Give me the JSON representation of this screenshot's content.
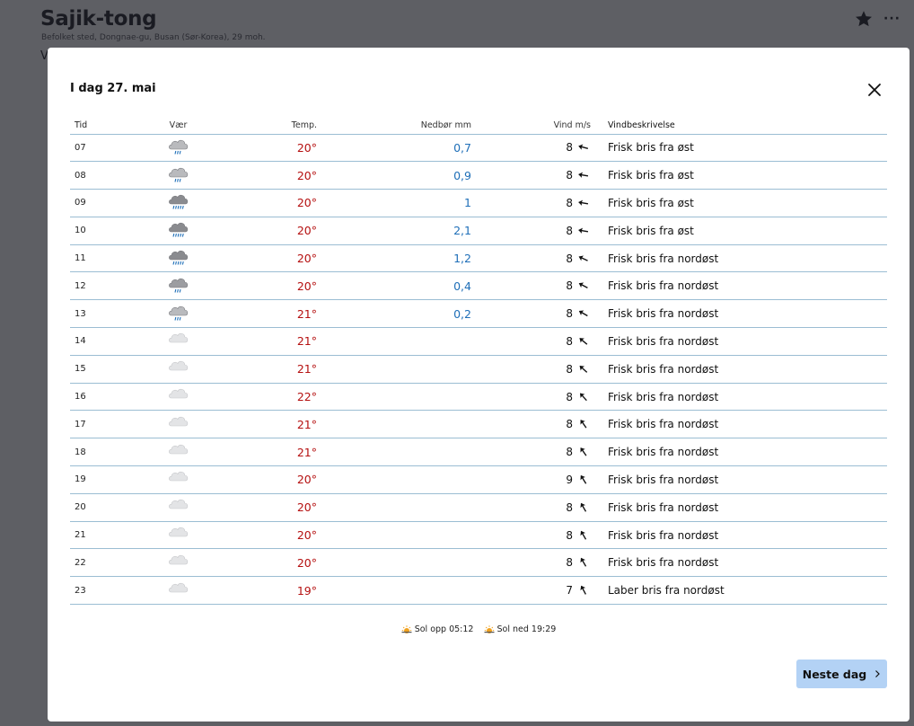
{
  "background": {
    "title": "Sajik-tong",
    "subtitle": "Befolket sted, Dongnae-gu, Busan (Sør-Korea), 29 moh.",
    "cut_text": "V",
    "star_icon": "star-icon",
    "more_icon": "more-icon"
  },
  "modal": {
    "title": "I dag 27. mai",
    "close_icon": "close-icon",
    "headers": {
      "tid": "Tid",
      "vaer": "Vær",
      "temp": "Temp.",
      "nedbor": "Nedbør mm",
      "vind": "Vind m/s",
      "desc": "Vindbeskrivelse"
    },
    "rows": [
      {
        "tid": "07",
        "icon": "rain-light",
        "temp": "20°",
        "precip": "0,7",
        "wind": "8",
        "dir_deg": 75,
        "desc": "Frisk bris fra øst"
      },
      {
        "tid": "08",
        "icon": "rain-light",
        "temp": "20°",
        "precip": "0,9",
        "wind": "8",
        "dir_deg": 80,
        "desc": "Frisk bris fra øst"
      },
      {
        "tid": "09",
        "icon": "rain-heavy",
        "temp": "20°",
        "precip": "1",
        "wind": "8",
        "dir_deg": 80,
        "desc": "Frisk bris fra øst"
      },
      {
        "tid": "10",
        "icon": "rain-heavy",
        "temp": "20°",
        "precip": "2,1",
        "wind": "8",
        "dir_deg": 80,
        "desc": "Frisk bris fra øst"
      },
      {
        "tid": "11",
        "icon": "rain-heavy",
        "temp": "20°",
        "precip": "1,2",
        "wind": "8",
        "dir_deg": 65,
        "desc": "Frisk bris fra nordøst"
      },
      {
        "tid": "12",
        "icon": "rain-medium",
        "temp": "20°",
        "precip": "0,4",
        "wind": "8",
        "dir_deg": 62,
        "desc": "Frisk bris fra nordøst"
      },
      {
        "tid": "13",
        "icon": "rain-light",
        "temp": "21°",
        "precip": "0,2",
        "wind": "8",
        "dir_deg": 60,
        "desc": "Frisk bris fra nordøst"
      },
      {
        "tid": "14",
        "icon": "cloud",
        "temp": "21°",
        "precip": "",
        "wind": "8",
        "dir_deg": 50,
        "desc": "Frisk bris fra nordøst"
      },
      {
        "tid": "15",
        "icon": "cloud",
        "temp": "21°",
        "precip": "",
        "wind": "8",
        "dir_deg": 48,
        "desc": "Frisk bris fra nordøst"
      },
      {
        "tid": "16",
        "icon": "cloud",
        "temp": "22°",
        "precip": "",
        "wind": "8",
        "dir_deg": 42,
        "desc": "Frisk bris fra nordøst"
      },
      {
        "tid": "17",
        "icon": "cloud",
        "temp": "21°",
        "precip": "",
        "wind": "8",
        "dir_deg": 35,
        "desc": "Frisk bris fra nordøst"
      },
      {
        "tid": "18",
        "icon": "cloud",
        "temp": "21°",
        "precip": "",
        "wind": "8",
        "dir_deg": 35,
        "desc": "Frisk bris fra nordøst"
      },
      {
        "tid": "19",
        "icon": "cloud",
        "temp": "20°",
        "precip": "",
        "wind": "9",
        "dir_deg": 32,
        "desc": "Frisk bris fra nordøst"
      },
      {
        "tid": "20",
        "icon": "cloud",
        "temp": "20°",
        "precip": "",
        "wind": "8",
        "dir_deg": 30,
        "desc": "Frisk bris fra nordøst"
      },
      {
        "tid": "21",
        "icon": "cloud",
        "temp": "20°",
        "precip": "",
        "wind": "8",
        "dir_deg": 30,
        "desc": "Frisk bris fra nordøst"
      },
      {
        "tid": "22",
        "icon": "cloud",
        "temp": "20°",
        "precip": "",
        "wind": "8",
        "dir_deg": 30,
        "desc": "Frisk bris fra nordøst"
      },
      {
        "tid": "23",
        "icon": "cloud",
        "temp": "19°",
        "precip": "",
        "wind": "7",
        "dir_deg": 28,
        "desc": "Laber bris fra nordøst"
      }
    ],
    "sunrise": "Sol opp 05:12",
    "sunset": "Sol ned 19:29",
    "sun_icon": "sun-horizon-icon",
    "next_button": "Neste dag",
    "next_icon": "chevron-right-icon"
  },
  "colors": {
    "temp_warm": "#b51010",
    "precip": "#1f6fb8",
    "divider": "#9bbdd3",
    "button_bg": "#b3d2f5",
    "backdrop": "#5e5f64"
  }
}
